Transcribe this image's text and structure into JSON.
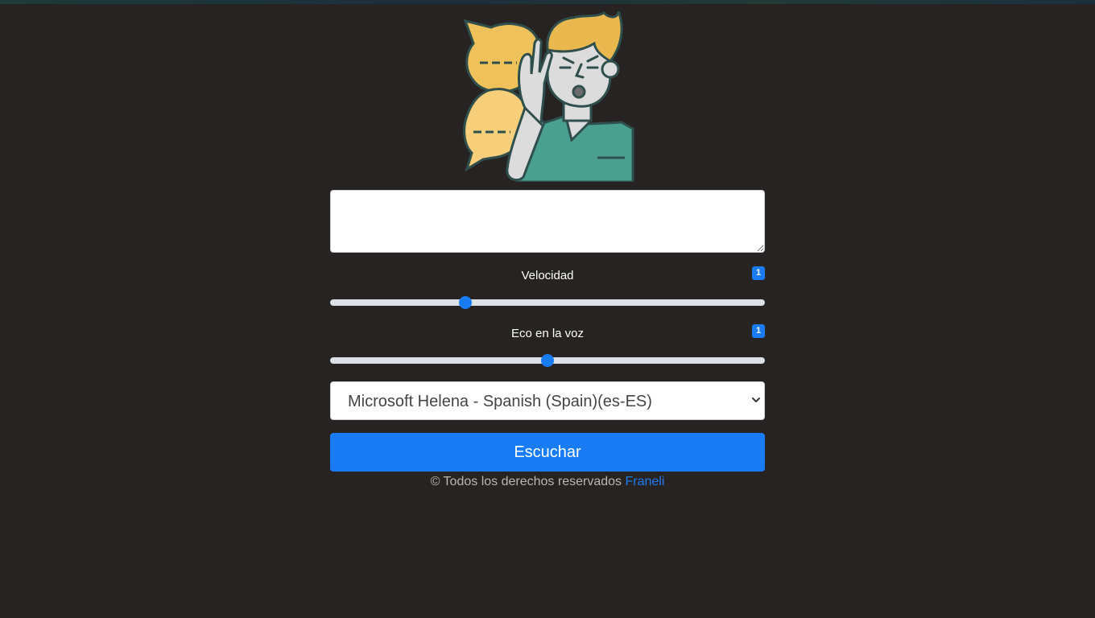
{
  "form": {
    "text_value": "",
    "speed": {
      "label": "Velocidad",
      "badge": "1",
      "value": 1,
      "min": 0.1,
      "max": 3
    },
    "echo": {
      "label": "Eco en la voz",
      "badge": "1",
      "value": 1,
      "min": 0,
      "max": 2
    },
    "voice": {
      "selected": "Microsoft Helena - Spanish (Spain)(es-ES)"
    },
    "listen_label": "Escuchar"
  },
  "footer": {
    "text": "© Todos los derechos reservados",
    "link_text": "Franeli"
  },
  "colors": {
    "background": "#272323",
    "accent": "#1a7cf5",
    "footer_text": "#b6b6b6"
  },
  "icons": {
    "hero": "person-listening-illustration",
    "select": "chevron-down-icon"
  }
}
